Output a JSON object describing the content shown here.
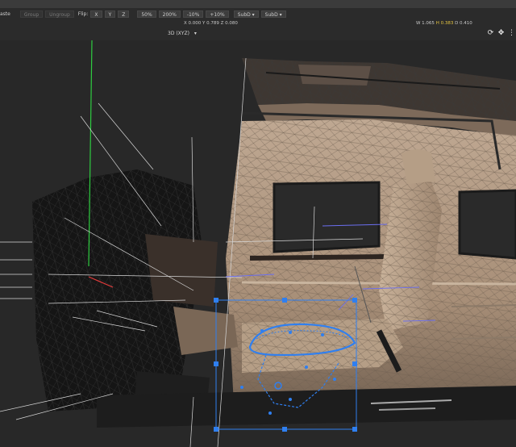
{
  "toolbar": {
    "paste_label": "aste",
    "group_label": "Group",
    "ungroup_label": "Ungroup",
    "flip_label": "Flip:",
    "flip_x": "X",
    "flip_y": "Y",
    "flip_z": "Z",
    "scale_50": "50%",
    "scale_200": "200%",
    "scale_minus10": "-10%",
    "scale_plus10": "+10%",
    "subd_1": "SubD ▾",
    "subd_2": "SubD ▾"
  },
  "status": {
    "coords": "X 0.000  Y 0.789  Z 0.080",
    "dims_w": "W 1.065",
    "dims_h": "H 0.383",
    "dims_d": "D 0.410"
  },
  "view": {
    "mode": "3D (XYZ)",
    "mode_arrow": "▾"
  },
  "icons": {
    "refresh": "refresh-icon",
    "move": "move-icon",
    "more": "more-icon"
  },
  "colors": {
    "highlight": "#e5c542",
    "selection": "#2f7ff0",
    "y_axis": "#2ecc40"
  }
}
